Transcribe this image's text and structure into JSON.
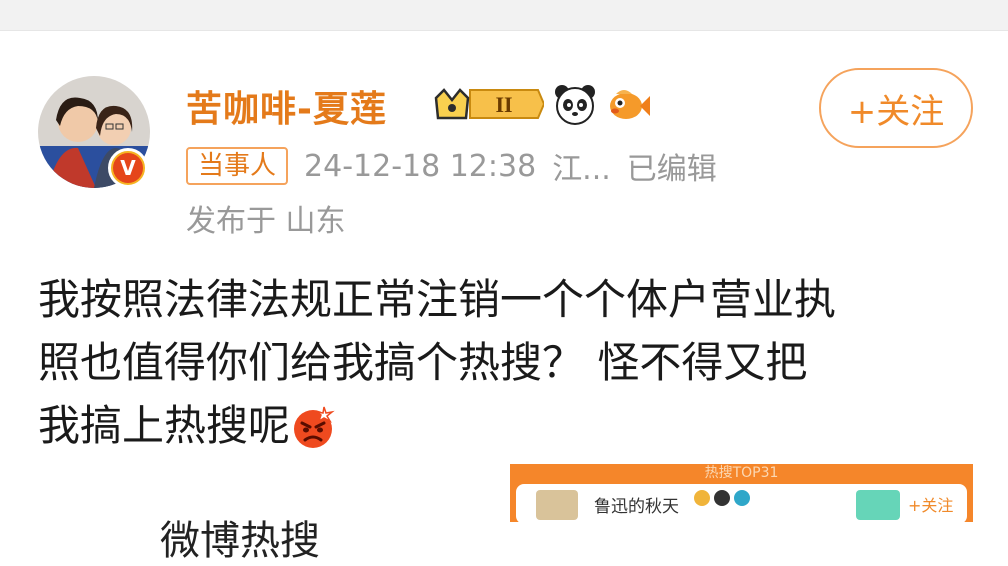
{
  "post": {
    "username": "苦咖啡-夏莲",
    "follow_label": "+关注",
    "role_tag": "当事人",
    "timestamp": "24-12-18 12:38",
    "source": "江...",
    "edited": "已编辑",
    "location": "发布于 山东",
    "content_lines": [
      "我按照法律法规正常注销一个个体户营业执",
      "照也值得你们给我搞个热搜？  怪不得又把",
      "我搞上热搜呢"
    ],
    "verified_badge": "V",
    "level_badge": "II"
  },
  "partial_text": "微博热搜",
  "card": {
    "title": "热搜TOP31",
    "user_name": "鲁迅的秋天",
    "follow_label": "+关注"
  },
  "colors": {
    "accent": "#e47a1a",
    "follow_border": "#f5a35c",
    "meta": "#999999",
    "card_bg": "#f5862a"
  },
  "icons": [
    "verified-v-icon",
    "crown-level-icon",
    "panda-icon",
    "fish-icon",
    "angry-emoji-icon"
  ]
}
